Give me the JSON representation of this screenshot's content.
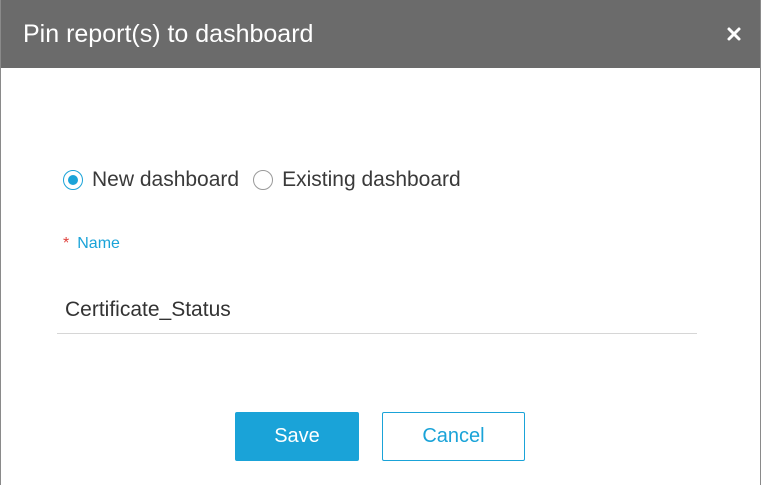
{
  "dialog": {
    "title": "Pin report(s) to dashboard",
    "close_icon": "close-icon"
  },
  "radio_options": [
    {
      "label": "New dashboard",
      "checked": true
    },
    {
      "label": "Existing dashboard",
      "checked": false
    }
  ],
  "name_field": {
    "required_mark": "*",
    "label": "Name",
    "value": "Certificate_Status"
  },
  "buttons": {
    "save_label": "Save",
    "cancel_label": "Cancel"
  },
  "colors": {
    "title_bar": "#6b6b6b",
    "accent": "#1aa3d8",
    "required": "#e0403b"
  }
}
